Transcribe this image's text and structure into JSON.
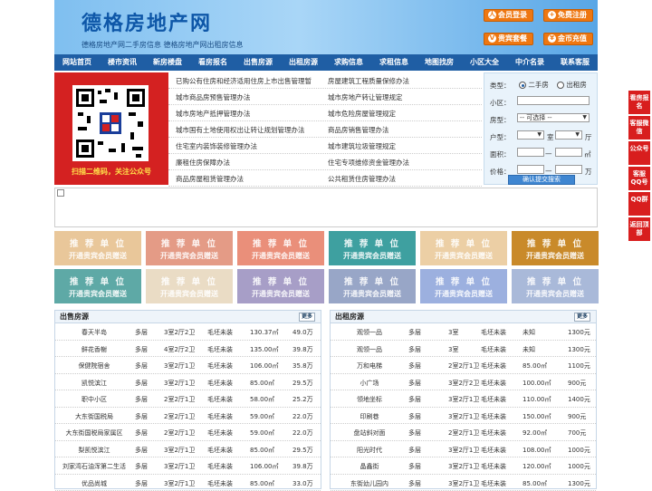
{
  "header": {
    "logo": "德格房地产网",
    "subline": "德格房地产网二手房信息   德格房地产网出租房信息",
    "buttons": [
      {
        "label": "会员登录",
        "icon": "user-icon",
        "glyph": "人"
      },
      {
        "label": "免费注册",
        "icon": "register-icon",
        "glyph": "+"
      },
      {
        "label": "贵宾套餐",
        "icon": "vip-icon",
        "glyph": "V"
      },
      {
        "label": "金币充值",
        "icon": "coin-icon",
        "glyph": "¥"
      }
    ]
  },
  "nav": [
    "网站首页",
    "楼市资讯",
    "新房楼盘",
    "看房报名",
    "出售房源",
    "出租房源",
    "求购信息",
    "求租信息",
    "地图找房",
    "小区大全",
    "中介名录",
    "联系客服"
  ],
  "qr": {
    "caption": "扫描二维码，关注公众号"
  },
  "links": [
    [
      "已购公有住房和经济适用住房上市出售管理暂",
      "房屋建筑工程质量保修办法"
    ],
    [
      "城市商品房预售管理办法",
      "城市房地产转让管理规定"
    ],
    [
      "城市房地产抵押管理办法",
      "城市危险房屋管理规定"
    ],
    [
      "城市国有土地使用权出让转让规划管理办法",
      "商品房销售管理办法"
    ],
    [
      "住宅室内装饰装修管理办法",
      "城市建筑垃圾管理规定"
    ],
    [
      "廉租住房保障办法",
      "住宅专项维修资金管理办法"
    ],
    [
      "商品房屋租赁管理办法",
      "公共租赁住房管理办法"
    ]
  ],
  "search": {
    "type_label": "类型：",
    "type_options": [
      "二手房",
      "出租房"
    ],
    "community_label": "小区：",
    "usage_label": "房型：",
    "usage_value": "-- 可选择 --",
    "layout_label": "户型：",
    "room_unit": "室",
    "hall_unit": "厅",
    "area_label": "面积：",
    "area_unit": "㎡",
    "price_label": "价格：",
    "price_unit": "万",
    "sep": "—",
    "submit": "确认提交搜索"
  },
  "recommend": {
    "title": "推 荐 单 位",
    "sub": "开通贵宾会员赠送",
    "colors": [
      "#e9c79a",
      "#e49b86",
      "#ea8f7a",
      "#3ea0a0",
      "#eccfa5",
      "#c98a2a",
      "#5ea9a6",
      "#eadcc5",
      "#a79ec7",
      "#98a6c7",
      "#9cb0df",
      "#a9b9d9"
    ]
  },
  "sale": {
    "title": "出售房源",
    "more": "更多",
    "rows": [
      [
        "春天半岛",
        "多层",
        "3室2厅2卫",
        "毛坯未装",
        "130.37㎡",
        "49.0万"
      ],
      [
        "鲜花香榭",
        "多层",
        "4室2厅2卫",
        "毛坯未装",
        "135.00㎡",
        "39.8万"
      ],
      [
        "保健院宿舍",
        "多层",
        "3室2厅1卫",
        "毛坯未装",
        "106.00㎡",
        "35.8万"
      ],
      [
        "凯悦滨江",
        "多层",
        "3室2厅1卫",
        "毛坯未装",
        "85.00㎡",
        "29.5万"
      ],
      [
        "职中小区",
        "多层",
        "2室2厅1卫",
        "毛坯未装",
        "58.00㎡",
        "25.2万"
      ],
      [
        "大东街国税局",
        "多层",
        "2室2厅1卫",
        "毛坯未装",
        "59.00㎡",
        "22.0万"
      ],
      [
        "大东街国税局家属区",
        "多层",
        "2室2厅1卫",
        "毛坯未装",
        "59.00㎡",
        "22.0万"
      ],
      [
        "梨凯悦滨江",
        "多层",
        "3室2厅1卫",
        "毛坯未装",
        "85.00㎡",
        "29.5万"
      ],
      [
        "刘家湾石油浑第二生活",
        "多层",
        "3室2厅1卫",
        "毛坯未装",
        "106.00㎡",
        "39.8万"
      ],
      [
        "优品尚城",
        "多层",
        "3室2厅1卫",
        "毛坯未装",
        "85.00㎡",
        "33.0万"
      ]
    ]
  },
  "rent": {
    "title": "出租房源",
    "more": "更多",
    "rows": [
      [
        "观领一品",
        "多层",
        "3室",
        "毛坯未装",
        "未知",
        "1300元"
      ],
      [
        "观领一品",
        "多层",
        "3室",
        "毛坯未装",
        "未知",
        "1300元"
      ],
      [
        "万和电梯",
        "多层",
        "2室2厅1卫",
        "毛坯未装",
        "85.00㎡",
        "1100元"
      ],
      [
        "小广场",
        "多层",
        "3室2厅2卫",
        "毛坯未装",
        "100.00㎡",
        "900元"
      ],
      [
        "领地坐标",
        "多层",
        "3室2厅1卫",
        "毛坯未装",
        "110.00㎡",
        "1400元"
      ],
      [
        "印刷巷",
        "多层",
        "3室2厅1卫",
        "毛坯未装",
        "150.00㎡",
        "900元"
      ],
      [
        "盘站斜对面",
        "多层",
        "2室2厅1卫",
        "毛坯未装",
        "92.00㎡",
        "700元"
      ],
      [
        "阳光时代",
        "多层",
        "3室2厅1卫",
        "毛坯未装",
        "108.00㎡",
        "1000元"
      ],
      [
        "晶鑫街",
        "多层",
        "3室2厅1卫",
        "毛坯未装",
        "120.00㎡",
        "1000元"
      ],
      [
        "东街幼儿园内",
        "多层",
        "3室2厅1卫",
        "毛坯未装",
        "85.00㎡",
        "1300元"
      ]
    ]
  },
  "side": [
    {
      "label": "看房报名",
      "icon": "signup-icon"
    },
    {
      "label": "客服微信",
      "icon": "wechat-icon"
    },
    {
      "label": "公众号",
      "icon": "official-account-icon"
    },
    {
      "label": "客服QQ号",
      "icon": "qq-icon"
    },
    {
      "label": "QQ群",
      "icon": "qq-group-icon"
    },
    {
      "label": "返回顶部",
      "icon": "back-to-top-icon"
    }
  ]
}
